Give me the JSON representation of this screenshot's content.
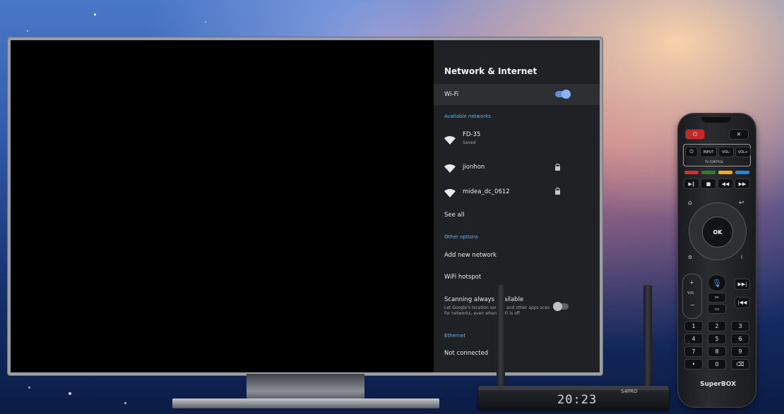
{
  "settings": {
    "title": "Network & Internet",
    "wifi_label": "Wi-Fi",
    "wifi_enabled": true,
    "available_networks_label": "Available networks",
    "networks": [
      {
        "name": "FD-35",
        "status": "Saved",
        "secured": false
      },
      {
        "name": "jionhon",
        "status": "",
        "secured": true
      },
      {
        "name": "midea_dc_0612",
        "status": "",
        "secured": true
      }
    ],
    "see_all_label": "See all",
    "other_options_label": "Other options",
    "add_network_label": "Add new network",
    "hotspot_label": "WiFi hotspot",
    "scanning_label": "Scanning always available",
    "scanning_desc_line1": "Let Google's location service and other apps scan",
    "scanning_desc_line2": "for networks, even when Wi-Fi is off",
    "scanning_enabled": false,
    "ethernet_label": "Ethernet",
    "ethernet_status": "Not connected"
  },
  "device": {
    "clock": "20:23",
    "model": "S4PRO"
  },
  "remote": {
    "input_label": "INPUT",
    "vol_minus_label": "VOL-",
    "vol_plus_label": "VOL+",
    "tv_control_label": "TV CONTROL",
    "ok_label": "OK",
    "vol_label": "VOL",
    "digits": [
      "1",
      "2",
      "3",
      "4",
      "5",
      "6",
      "7",
      "8",
      "9",
      "•",
      "0",
      "⌫"
    ],
    "brand": "SuperBOX"
  },
  "colors": {
    "accent": "#8ab4f8",
    "panel_bg": "#202124",
    "power_red": "#c62828",
    "color_keys": [
      "#d32f2f",
      "#2e7d32",
      "#f9a825",
      "#1e88e5"
    ]
  },
  "icons": [
    "wifi-icon",
    "lock-icon",
    "power-icon",
    "mute-icon",
    "home-icon",
    "back-icon",
    "mic-icon",
    "play-pause-icon",
    "stop-icon",
    "rewind-icon",
    "fast-forward-icon"
  ]
}
